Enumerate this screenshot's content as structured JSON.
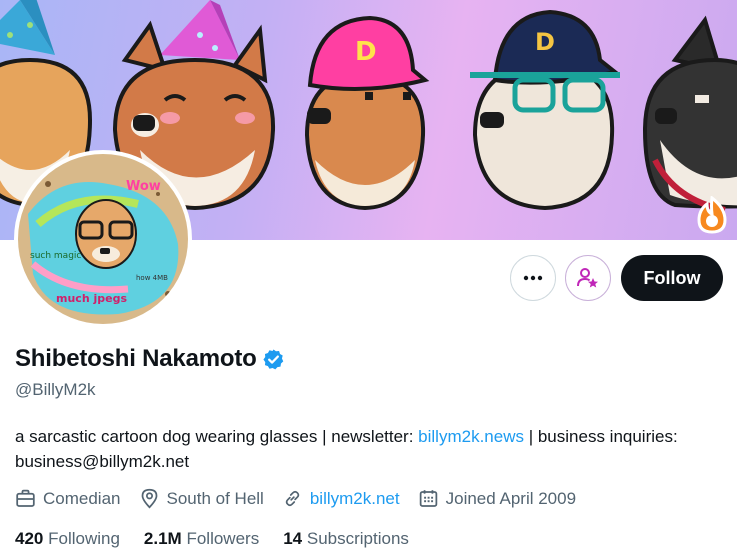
{
  "profile": {
    "display_name": "Shibetoshi Nakamoto",
    "handle": "@BillyM2k",
    "verified": true,
    "bio_text": "a sarcastic cartoon dog wearing glasses | newsletter: ",
    "bio_link": "billym2k.news",
    "bio_text_2": " | business inquiries: business@billym2k.net"
  },
  "avatar": {
    "caption_wow": "Wow",
    "caption_magic": "such magic",
    "caption_jpegs": "much jpegs",
    "caption_how": "how 4MB"
  },
  "banner": {
    "cap_letter": "D"
  },
  "actions": {
    "follow_label": "Follow"
  },
  "meta": {
    "profession": "Comedian",
    "location": "South of Hell",
    "website": "billym2k.net",
    "joined": "Joined April 2009"
  },
  "stats": {
    "following_count": "420",
    "following_label": "Following",
    "followers_count": "2.1M",
    "followers_label": "Followers",
    "subscriptions_count": "14",
    "subscriptions_label": "Subscriptions"
  },
  "colors": {
    "accent": "#1d9bf0",
    "follow_button": "#0f1419",
    "secondary_text": "#536471"
  }
}
